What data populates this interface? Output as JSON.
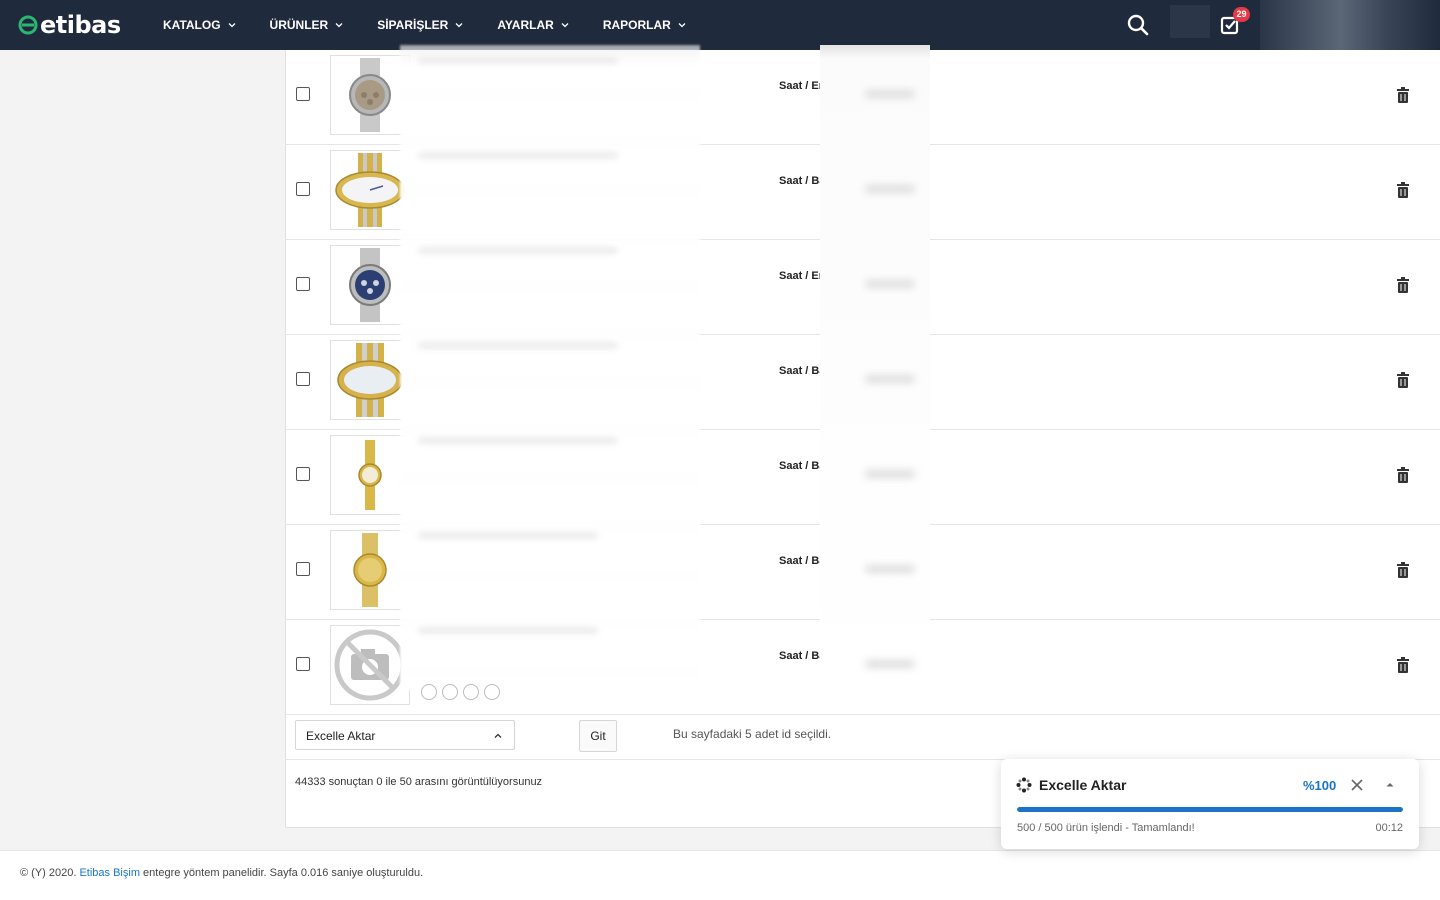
{
  "header": {
    "logo_text": "etibas",
    "nav": [
      {
        "label": "KATALOG"
      },
      {
        "label": "ÜRÜNLER"
      },
      {
        "label": "SİPARİŞLER"
      },
      {
        "label": "AYARLAR"
      },
      {
        "label": "RAPORLAR"
      }
    ],
    "icons": [
      "search-icon",
      "orders-check-icon",
      "chevron-down-icon"
    ],
    "orders_badge": "29",
    "colors": {
      "bar": "#1f2a3c",
      "badge": "#e63946",
      "logo_mark": "#2bb673"
    }
  },
  "products": {
    "rows": [
      {
        "category": "Saat / Er",
        "image": "silver-chronograph-watch"
      },
      {
        "category": "Saat / Ba",
        "image": "two-tone-oval-watch"
      },
      {
        "category": "Saat / Er",
        "image": "blue-dial-chronograph-watch"
      },
      {
        "category": "Saat / Ba",
        "image": "two-tone-pearl-watch"
      },
      {
        "category": "Saat / Ba",
        "image": "small-gold-watch"
      },
      {
        "category": "Saat / Ba",
        "image": "gold-dial-watch"
      },
      {
        "category": "Saat / Ba",
        "image": "no-photo-icon"
      }
    ]
  },
  "bulk_actions": {
    "selected_action": "Excelle Aktar",
    "go_label": "Git",
    "selected_info": "Bu sayfadaki 5 adet id seçildi."
  },
  "pagination": {
    "results_info": "44333 sonuçtan 0 ile 50 arasını görüntülüyorsunuz"
  },
  "footer": {
    "prefix": "© (Y) 2020. ",
    "link": "Etibas Bişim",
    "suffix": " entegre yöntem panelidir. Sayfa 0.016 saniye oluşturuldu."
  },
  "export_toast": {
    "title": "Excelle Aktar",
    "percent_label": "%100",
    "progress": 1.0,
    "status": "500 / 500 ürün işlendi - Tamamlandı!",
    "elapsed": "00:12",
    "accent": "#1a73c6"
  }
}
